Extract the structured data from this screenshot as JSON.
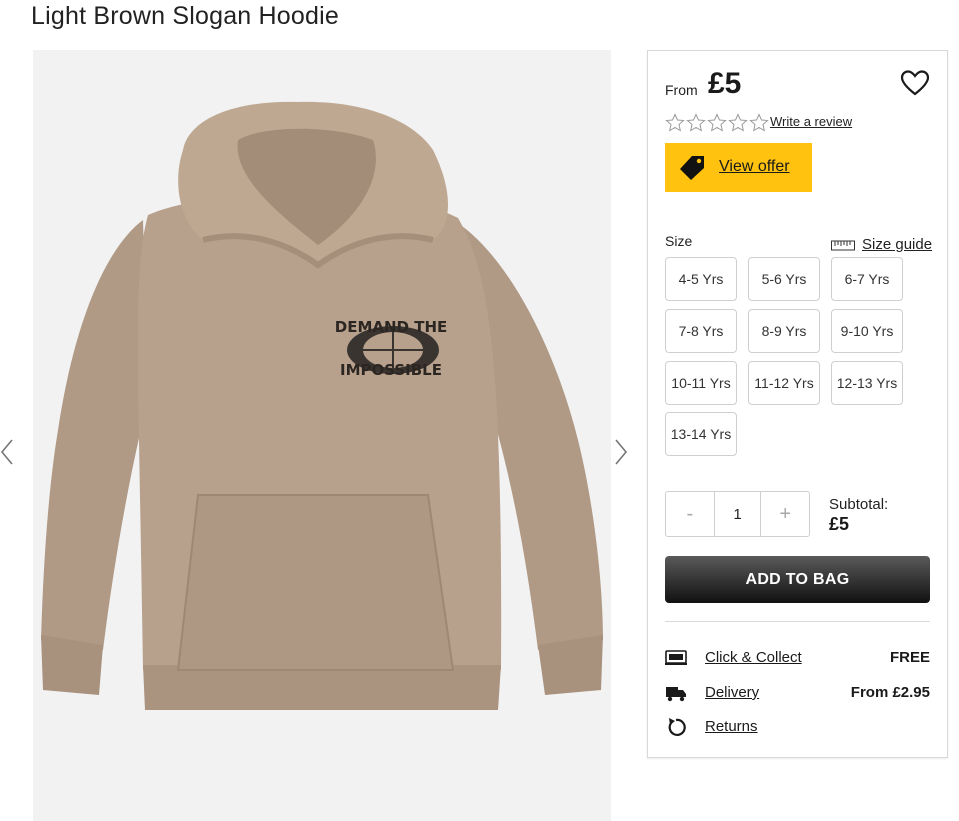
{
  "product": {
    "title": "Light Brown Slogan Hoodie",
    "image_slogan_top": "DEMAND THE",
    "image_slogan_bottom": "IMPOSSIBLE"
  },
  "gallery": {
    "prev_icon": "chevron-left-icon",
    "next_icon": "chevron-right-icon"
  },
  "pricing": {
    "from_label": "From",
    "price": "£5"
  },
  "wishlist": {
    "icon": "heart-icon"
  },
  "rating": {
    "stars_filled": 0,
    "stars_total": 5,
    "write_review": "Write a review"
  },
  "offer": {
    "label": "View offer",
    "icon": "tag-icon",
    "color": "#ffc20e"
  },
  "size": {
    "label": "Size",
    "guide_label": "Size guide",
    "guide_icon": "ruler-icon",
    "options": [
      "4-5 Yrs",
      "5-6 Yrs",
      "6-7 Yrs",
      "7-8 Yrs",
      "8-9 Yrs",
      "9-10 Yrs",
      "10-11 Yrs",
      "11-12 Yrs",
      "12-13 Yrs",
      "13-14 Yrs"
    ]
  },
  "quantity": {
    "minus": "-",
    "value": "1",
    "plus": "+"
  },
  "subtotal": {
    "label": "Subtotal:",
    "value": "£5"
  },
  "add_to_bag": "ADD TO BAG",
  "fulfilment": [
    {
      "icon": "click-collect-icon",
      "label": "Click & Collect",
      "value": "FREE"
    },
    {
      "icon": "delivery-truck-icon",
      "label": "Delivery",
      "value": "From £2.95"
    },
    {
      "icon": "returns-icon",
      "label": "Returns",
      "value": ""
    }
  ]
}
